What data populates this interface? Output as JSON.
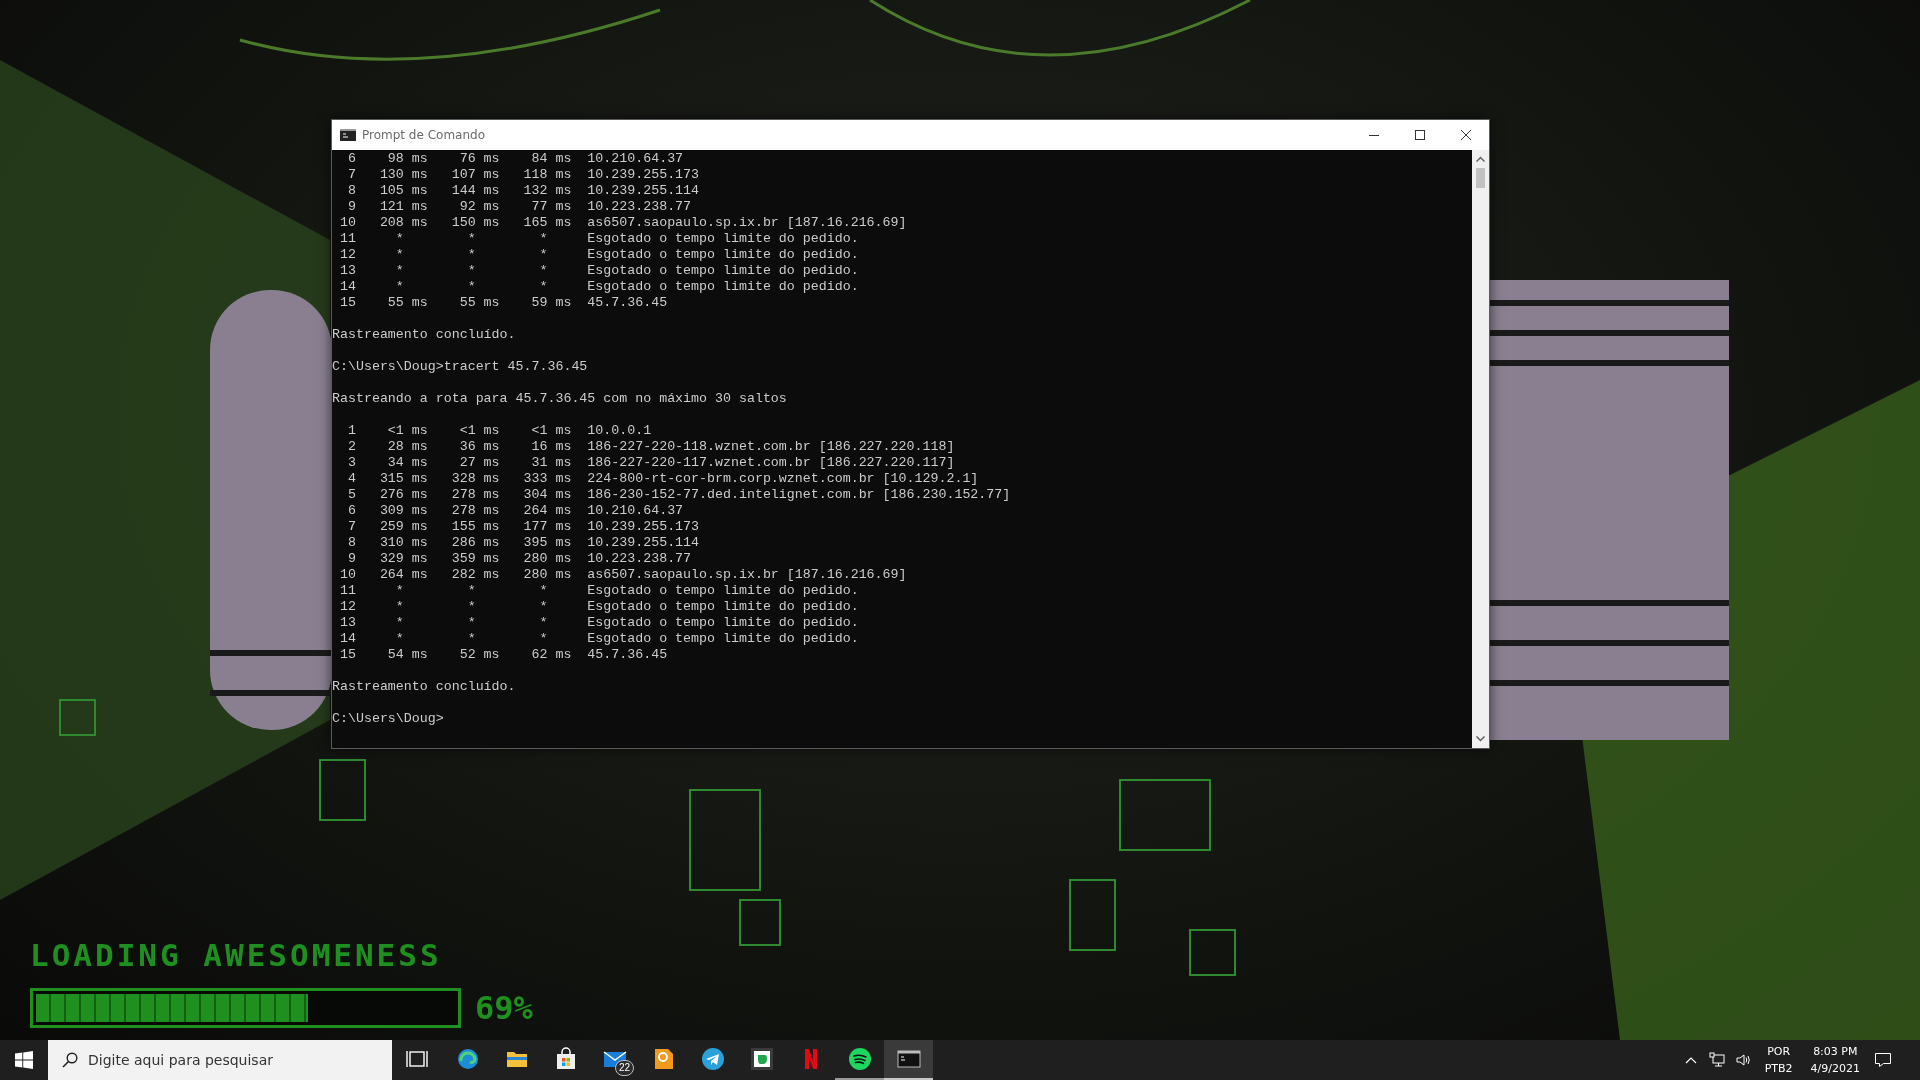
{
  "wallpaper": {
    "caption": "LOADING AWESOMENESS",
    "level": 0.65,
    "reading": "69%"
  },
  "window": {
    "title": "Prompt de Comando",
    "console": {
      "lines": [
        {
          "text": "  6    98 ms    76 ms    84 ms  10.210.64.37"
        },
        {
          "text": "  7   130 ms   107 ms   118 ms  10.239.255.173"
        },
        {
          "text": "  8   105 ms   144 ms   132 ms  10.239.255.114"
        },
        {
          "text": "  9   121 ms    92 ms    77 ms  10.223.238.77"
        },
        {
          "text": " 10   208 ms   150 ms   165 ms  as6507.saopaulo.sp.ix.br [187.16.216.69]"
        },
        {
          "text": " 11     *        *        *     Esgotado o tempo limite do pedido."
        },
        {
          "text": " 12     *        *        *     Esgotado o tempo limite do pedido."
        },
        {
          "text": " 13     *        *        *     Esgotado o tempo limite do pedido."
        },
        {
          "text": " 14     *        *        *     Esgotado o tempo limite do pedido."
        },
        {
          "text": " 15    55 ms    55 ms    59 ms  45.7.36.45"
        },
        {
          "text": "Rastreamento concluído.",
          "space_before": true
        },
        {
          "text": "C:\\Users\\Doug>tracert 45.7.36.45",
          "space_before": true
        },
        {
          "text": "Rastreando a rota para 45.7.36.45 com no máximo 30 saltos",
          "space_before": true
        },
        {
          "text": "  1    <1 ms    <1 ms    <1 ms  10.0.0.1",
          "space_before": true
        },
        {
          "text": "  2    28 ms    36 ms    16 ms  186-227-220-118.wznet.com.br [186.227.220.118]"
        },
        {
          "text": "  3    34 ms    27 ms    31 ms  186-227-220-117.wznet.com.br [186.227.220.117]"
        },
        {
          "text": "  4   315 ms   328 ms   333 ms  224-800-rt-cor-brm.corp.wznet.com.br [10.129.2.1]"
        },
        {
          "text": "  5   276 ms   278 ms   304 ms  186-230-152-77.ded.intelignet.com.br [186.230.152.77]"
        },
        {
          "text": "  6   309 ms   278 ms   264 ms  10.210.64.37"
        },
        {
          "text": "  7   259 ms   155 ms   177 ms  10.239.255.173"
        },
        {
          "text": "  8   310 ms   286 ms   395 ms  10.239.255.114"
        },
        {
          "text": "  9   329 ms   359 ms   280 ms  10.223.238.77"
        },
        {
          "text": " 10   264 ms   282 ms   280 ms  as6507.saopaulo.sp.ix.br [187.16.216.69]"
        },
        {
          "text": " 11     *        *        *     Esgotado o tempo limite do pedido."
        },
        {
          "text": " 12     *        *        *     Esgotado o tempo limite do pedido."
        },
        {
          "text": " 13     *        *        *     Esgotado o tempo limite do pedido."
        },
        {
          "text": " 14     *        *        *     Esgotado o tempo limite do pedido."
        },
        {
          "text": " 15    54 ms    52 ms    62 ms  45.7.36.45"
        },
        {
          "text": "Rastreamento concluído.",
          "space_before": true
        },
        {
          "text": "C:\\Users\\Doug>",
          "space_before": true
        }
      ]
    }
  },
  "taskbar": {
    "search": {
      "placeholder": "Digite aqui para pesquisar"
    },
    "apps": [
      {
        "kind": "taskview",
        "running": false,
        "active": false
      },
      {
        "kind": "browser",
        "running": false,
        "active": false
      },
      {
        "kind": "folder",
        "running": false,
        "active": false
      },
      {
        "kind": "store",
        "running": false,
        "active": false
      },
      {
        "kind": "mail",
        "badge": "22",
        "running": false,
        "active": false
      },
      {
        "kind": "pdf",
        "running": false,
        "active": false
      },
      {
        "kind": "telegram",
        "running": false,
        "active": false
      },
      {
        "kind": "notes",
        "running": false,
        "active": false
      },
      {
        "kind": "netflix",
        "running": false,
        "active": false
      },
      {
        "kind": "spotify",
        "running": true,
        "active": false
      },
      {
        "kind": "terminal",
        "running": true,
        "active": true
      }
    ],
    "tray": {
      "language": "POR",
      "layout": "PTB2",
      "time": "8:03 PM",
      "date": "4/9/2021"
    }
  }
}
